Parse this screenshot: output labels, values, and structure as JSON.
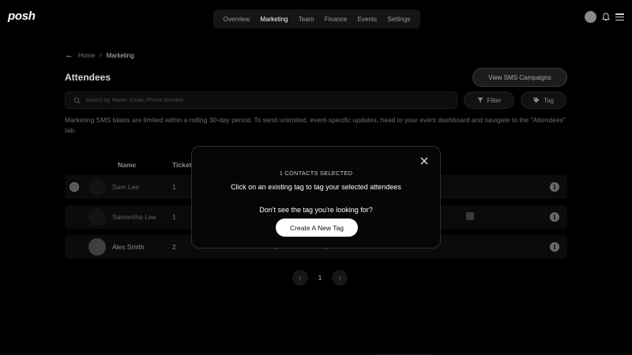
{
  "app": {
    "logo": "posh"
  },
  "nav": {
    "items": [
      {
        "label": "Overview"
      },
      {
        "label": "Marketing"
      },
      {
        "label": "Team"
      },
      {
        "label": "Finance"
      },
      {
        "label": "Events"
      },
      {
        "label": "Settings"
      }
    ],
    "active": "Marketing"
  },
  "breadcrumb": {
    "parent": "Home",
    "separator": "/",
    "current": "Marketing"
  },
  "page": {
    "title": "Attendees",
    "sms_button": "View SMS Campaigns",
    "search_placeholder": "Search by Name, Email, Phone Number",
    "filter_label": "Filter",
    "tag_label": "Tag",
    "notice": "Marketing SMS blasts are limited within a rolling 30-day period. To send unlimited, event-specific updates, head to your event dashboard and navigate to the \"Attendees\" tab."
  },
  "table": {
    "headers": [
      "Name",
      "Tickets"
    ],
    "rows": [
      {
        "name": "Sam Lee",
        "tickets": "1"
      },
      {
        "name": "Samantha Lee",
        "tickets": "1"
      },
      {
        "name": "Alex Smith",
        "tickets": "2"
      }
    ]
  },
  "pagination": {
    "prev": "‹",
    "current": "1",
    "next": "›"
  },
  "modal": {
    "count_text": "1 CONTACTS SELECTED",
    "instruction": "Click on an existing tag to tag your selected attendees",
    "hint": "Don't see the tag you're looking for?",
    "create_button": "Create A New Tag"
  },
  "icons": {
    "back": "arrow-left-icon",
    "search": "search-icon",
    "filter": "filter-icon",
    "tag": "tag-icon",
    "info": "info-icon",
    "close": "close-icon",
    "bell": "bell-icon",
    "menu": "hamburger-menu-icon"
  },
  "colors": {
    "background": "#000000",
    "modal_bg": "#060606",
    "primary_button": "#ffffff"
  }
}
